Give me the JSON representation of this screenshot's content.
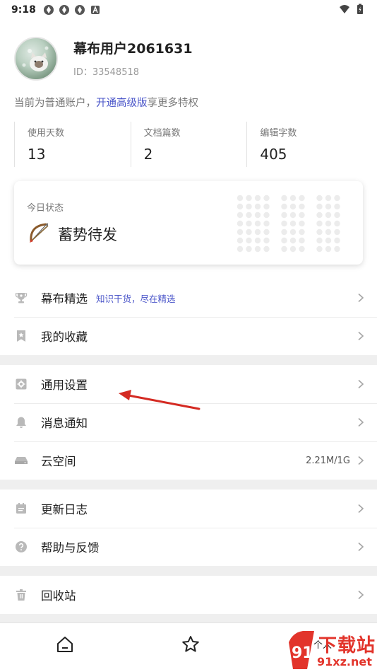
{
  "status_bar": {
    "time": "9:18"
  },
  "profile": {
    "username": "幕布用户2061631",
    "user_id": "ID：33548518",
    "account_prefix": "当前为普通账户，",
    "account_link": "开通高级版",
    "account_suffix": "享更多特权"
  },
  "stats": [
    {
      "label": "使用天数",
      "value": "13"
    },
    {
      "label": "文档篇数",
      "value": "2"
    },
    {
      "label": "编辑字数",
      "value": "405"
    }
  ],
  "today_status": {
    "label": "今日状态",
    "text": "蓄势待发"
  },
  "menu": {
    "featured": {
      "label": "幕布精选",
      "tag": "知识干货，尽在精选"
    },
    "favorites": {
      "label": "我的收藏"
    },
    "general_settings": {
      "label": "通用设置"
    },
    "notifications": {
      "label": "消息通知"
    },
    "cloud_space": {
      "label": "云空间",
      "value": "2.21M/1G"
    },
    "changelog": {
      "label": "更新日志"
    },
    "help_feedback": {
      "label": "帮助与反馈"
    },
    "recycle_bin": {
      "label": "回收站"
    }
  },
  "bottom_nav": {
    "personal_label": "个人"
  },
  "watermark": {
    "text_top": "下载站",
    "text_bottom": "91xz.net",
    "logo_text": "91"
  },
  "colors": {
    "accent": "#4a55c9",
    "arrow": "#d42a22",
    "watermark": "#e2342b"
  }
}
